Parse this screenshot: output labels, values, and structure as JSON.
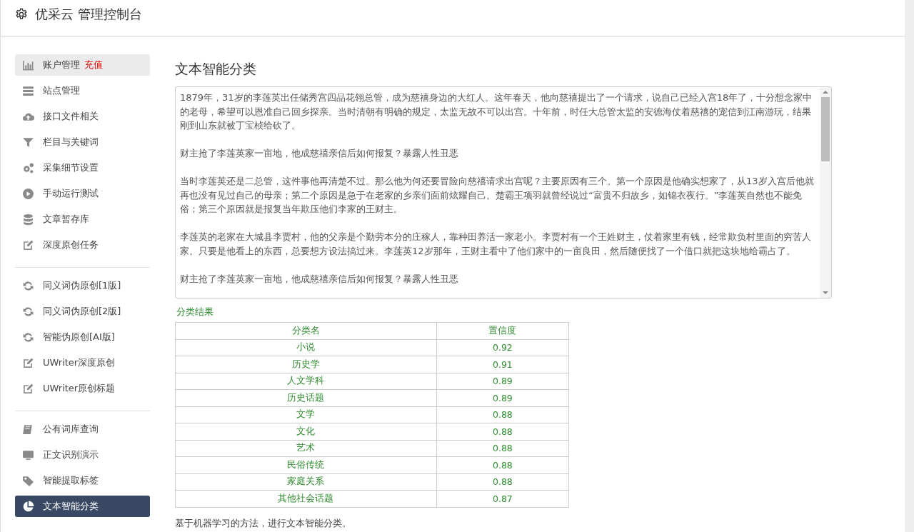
{
  "header": {
    "title": "优采云 管理控制台"
  },
  "sidebar": {
    "groups": [
      {
        "items": [
          {
            "label": "账户管理",
            "link": "充值",
            "selected": false,
            "hovered": true
          },
          {
            "label": "站点管理",
            "selected": false,
            "hovered": false
          },
          {
            "label": "接口文件相关",
            "selected": false,
            "hovered": false
          },
          {
            "label": "栏目与关键词",
            "selected": false,
            "hovered": false
          },
          {
            "label": "采集细节设置",
            "selected": false,
            "hovered": false
          },
          {
            "label": "手动运行测试",
            "selected": false,
            "hovered": false
          },
          {
            "label": "文章暂存库",
            "selected": false,
            "hovered": false
          },
          {
            "label": "深度原创任务",
            "selected": false,
            "hovered": false
          }
        ]
      },
      {
        "items": [
          {
            "label": "同义词伪原创[1版]",
            "selected": false,
            "hovered": false
          },
          {
            "label": "同义词伪原创[2版]",
            "selected": false,
            "hovered": false
          },
          {
            "label": "智能伪原创[AI版]",
            "selected": false,
            "hovered": false
          },
          {
            "label": "UWriter深度原创",
            "selected": false,
            "hovered": false
          },
          {
            "label": "UWriter原创标题",
            "selected": false,
            "hovered": false
          }
        ]
      },
      {
        "items": [
          {
            "label": "公有词库查询",
            "selected": false,
            "hovered": false
          },
          {
            "label": "正文识别演示",
            "selected": false,
            "hovered": false
          },
          {
            "label": "智能提取标签",
            "selected": false,
            "hovered": false
          },
          {
            "label": "文本智能分类",
            "selected": true,
            "hovered": false
          }
        ]
      }
    ]
  },
  "content": {
    "title": "文本智能分类",
    "input_text": [
      "1879年，31岁的李莲英出任储秀宫四品花翎总管，成为慈禧身边的大红人。这年春天，他向慈禧提出了一个请求，说自己已经入宫18年了，十分想念家中的老母，希望可以恩准自己回乡探亲。当时清朝有明确的规定，太监无故不可以出宫。十年前，时任大总管太监的安德海仗着慈禧的宠信到江南游玩，结果刚到山东就被丁宝桢给砍了。",
      "财主抢了李莲英家一亩地，他成慈禧亲信后如何报复？暴露人性丑恶",
      "当时李莲英还是二总管，这件事他再清楚不过。那么他为何还要冒险向慈禧请求出宫呢？主要原因有三个。第一个原因是他确实想家了，从13岁入宫后他就再也没有见过自己的母亲；第二个原因是急于在老家的乡亲们面前炫耀自己。楚霸王项羽就曾经说过“富贵不归故乡，如锦衣夜行。”李莲英自然也不能免俗；第三个原因就是报复当年欺压他们李家的王财主。",
      "李莲英的老家在大城县李贾村，他的父亲是个勤劳本分的庄稼人，靠种田养活一家老小。李贾村有一个王姓财主，仗着家里有钱，经常欺负村里面的穷苦人家。只要是他看上的东西，总要想方设法搞过来。李莲英12岁那年，王财主看中了他们家中的一亩良田，然后随便找了一个借口就把这块地给霸占了。",
      "财主抢了李莲英家一亩地，他成慈禧亲信后如何报复？暴露人性丑恶"
    ],
    "result_table": {
      "caption": "分类结果",
      "columns": [
        "分类名",
        "置信度"
      ],
      "rows": [
        [
          "小说",
          "0.92"
        ],
        [
          "历史学",
          "0.91"
        ],
        [
          "人文学科",
          "0.89"
        ],
        [
          "历史话题",
          "0.89"
        ],
        [
          "文学",
          "0.88"
        ],
        [
          "文化",
          "0.88"
        ],
        [
          "艺术",
          "0.88"
        ],
        [
          "民俗传统",
          "0.88"
        ],
        [
          "家庭关系",
          "0.88"
        ],
        [
          "其他社会话题",
          "0.87"
        ]
      ]
    },
    "description": "基于机器学习的方法，进行文本智能分类。"
  }
}
